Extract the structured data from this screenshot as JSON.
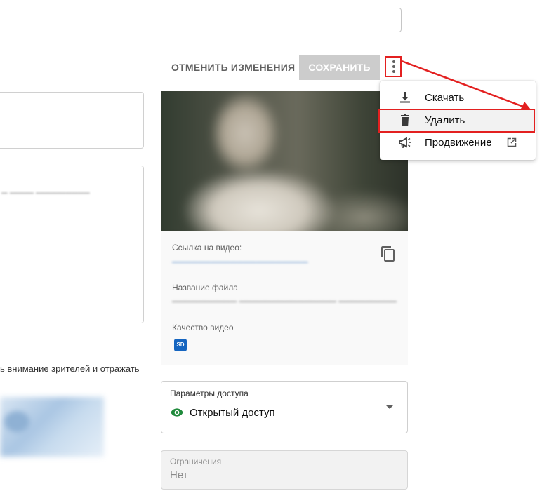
{
  "toolbar": {
    "cancel_label": "ОТМЕНИТЬ ИЗМЕНЕНИЯ",
    "save_label": "СОХРАНИТЬ",
    "more_icon": "more-vert-icon"
  },
  "menu": {
    "items": [
      {
        "label": "Скачать",
        "icon": "download-icon"
      },
      {
        "label": "Удалить",
        "icon": "trash-icon"
      },
      {
        "label": "Продвижение",
        "icon": "megaphone-icon",
        "trailing_icon": "external-link-icon"
      }
    ]
  },
  "left": {
    "thumbnail_hint": "ь внимание зрителей и отражать"
  },
  "video": {
    "link_label": "Ссылка на видео:",
    "file_label": "Название файла",
    "quality_label": "Качество видео",
    "quality_badge": "SD"
  },
  "access": {
    "label": "Параметры доступа",
    "value": "Открытый доступ"
  },
  "restrictions": {
    "label": "Ограничения",
    "value": "Нет"
  },
  "colors": {
    "annotation": "#e32020",
    "link": "#3c7ac2",
    "eye": "#1f8a3b",
    "badge": "#1565c0"
  }
}
